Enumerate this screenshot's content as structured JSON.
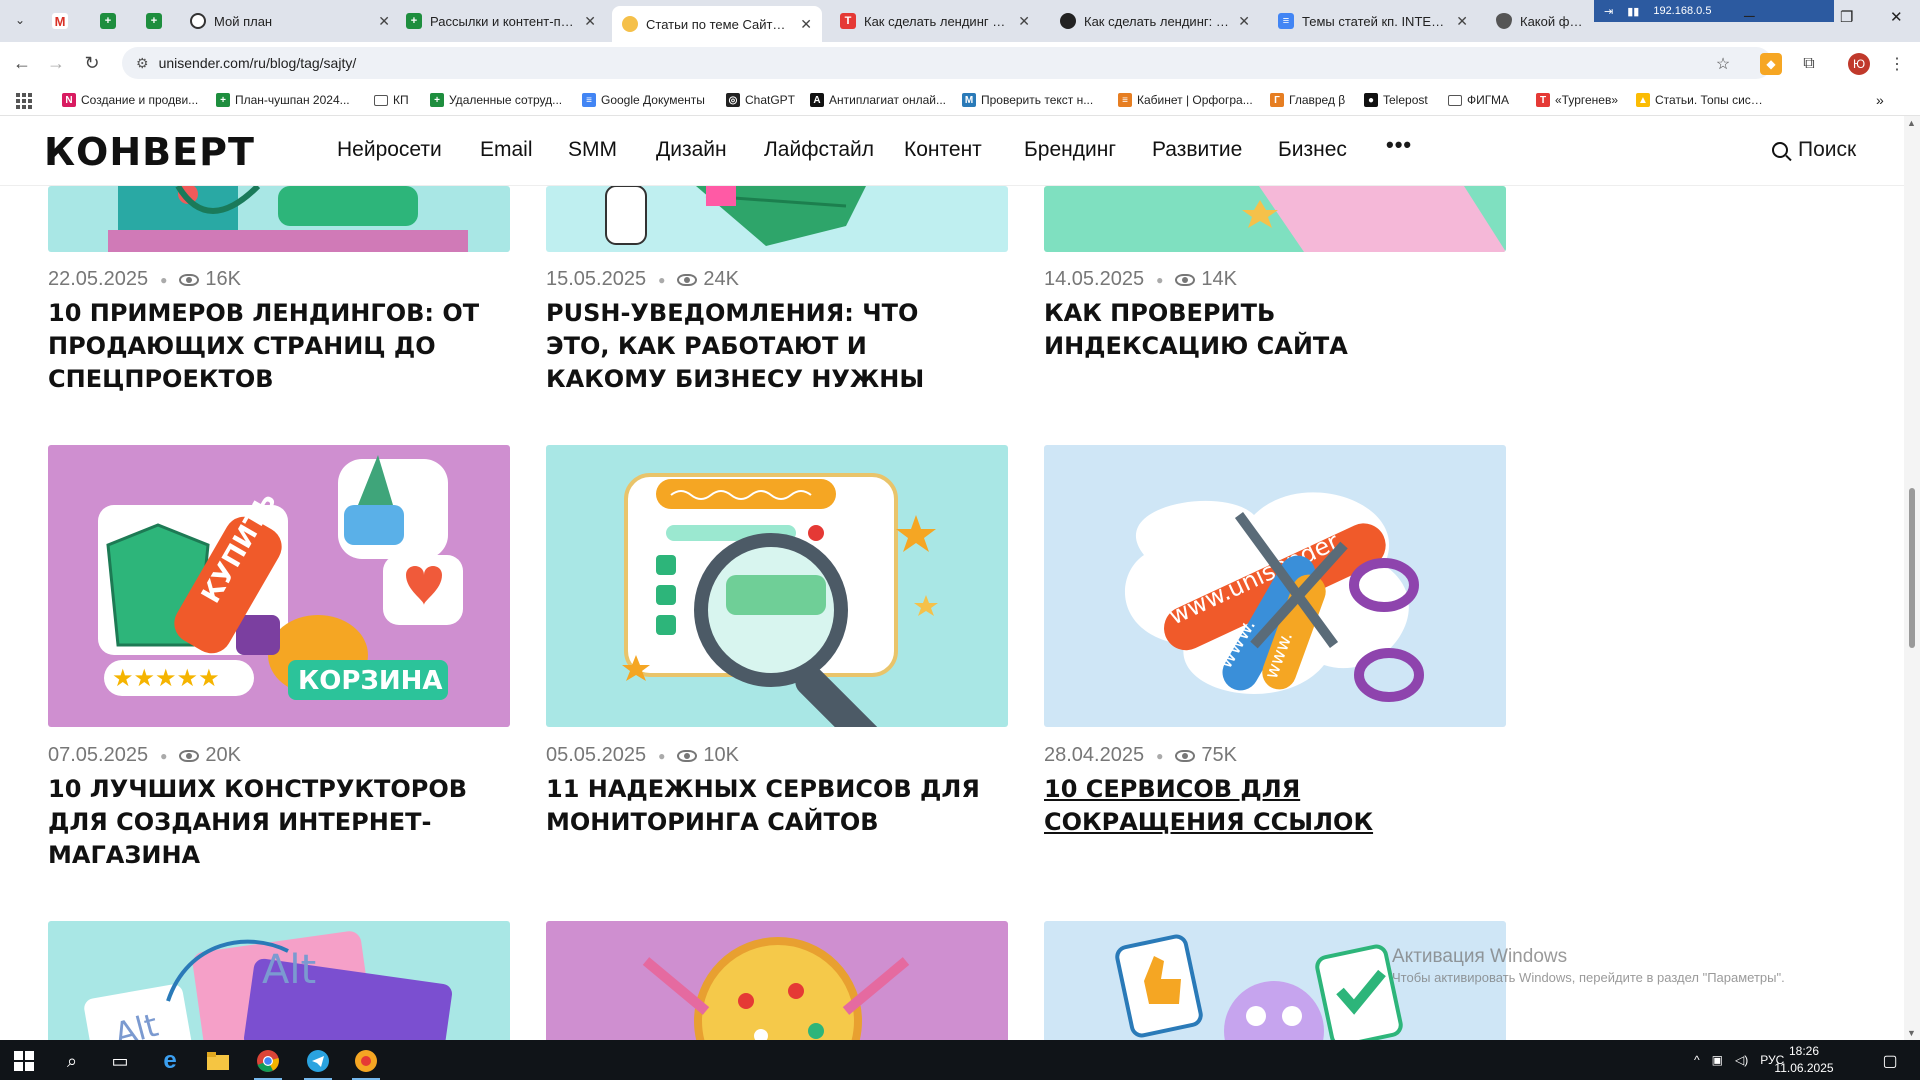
{
  "browser": {
    "tabs": [
      {
        "title": "",
        "icon": "gmail-icon"
      },
      {
        "title": "",
        "icon": "sheets-icon"
      },
      {
        "title": "",
        "icon": "sheets-icon"
      },
      {
        "title": "Мой план",
        "icon": "ring-icon"
      },
      {
        "title": "Рассылки и контент-план",
        "icon": "sheets-icon"
      },
      {
        "title": "Статьи по теме Сайты | Ко",
        "icon": "konvert-icon"
      },
      {
        "title": "Как сделать лендинг для",
        "icon": "t-icon"
      },
      {
        "title": "Как сделать лендинг: пош",
        "icon": "dark-icon"
      },
      {
        "title": "Темы статей кп. INTEC - Go",
        "icon": "docs-icon"
      },
      {
        "title": "Какой форма",
        "icon": "shield-icon"
      }
    ],
    "network_label": "192.168.0.5",
    "address": "unisender.com/ru/blog/tag/sajty/",
    "profile_initial": "Ю",
    "bookmarks": [
      {
        "label": "Создание и продви...",
        "icon": "n-icon",
        "color": "#d81b60"
      },
      {
        "label": "План-чушпан 2024...",
        "icon": "sheets-icon",
        "color": "#1e8e3e"
      },
      {
        "label": "КП",
        "icon": "folder-icon",
        "color": ""
      },
      {
        "label": "Удаленные сотруд...",
        "icon": "sheets-icon",
        "color": "#1e8e3e"
      },
      {
        "label": "Google Документы",
        "icon": "docs-icon",
        "color": "#4285f4"
      },
      {
        "label": "ChatGPT",
        "icon": "chatgpt-icon",
        "color": "#222222"
      },
      {
        "label": "Антиплагиат онлай...",
        "icon": "a-icon",
        "color": "#111111"
      },
      {
        "label": "Проверить текст н...",
        "icon": "m-icon",
        "color": "#2a7ab8"
      },
      {
        "label": "Кабинет | Орфогра...",
        "icon": "lines-icon",
        "color": "#e67e22"
      },
      {
        "label": "Главред β",
        "icon": "glavred-icon",
        "color": "#e67e22"
      },
      {
        "label": "Telepost",
        "icon": "telepost-icon",
        "color": "#111111"
      },
      {
        "label": "ФИГМА",
        "icon": "folder-icon",
        "color": ""
      },
      {
        "label": "«Тургенев»",
        "icon": "t-icon",
        "color": "#e53935"
      },
      {
        "label": "Статьи. Топы систе...",
        "icon": "drive-icon",
        "color": "#fbbc04"
      }
    ]
  },
  "site": {
    "logo": "КОНВЕРТ",
    "menu": [
      "Нейросети",
      "Email",
      "SMM",
      "Дизайн",
      "Лайфстайл",
      "Контент",
      "Брендинг",
      "Развитие",
      "Бизнес"
    ],
    "more": "•••",
    "search_label": "Поиск"
  },
  "articles": [
    {
      "date": "22.05.2025",
      "views": "16K",
      "title": "10 примеров лендингов: от продающих страниц до спецпроектов"
    },
    {
      "date": "15.05.2025",
      "views": "24K",
      "title": "Push-уведомления: что это, как работают и какому бизнесу нужны"
    },
    {
      "date": "14.05.2025",
      "views": "14K",
      "title": "Как проверить индексацию сайта"
    },
    {
      "date": "07.05.2025",
      "views": "20K",
      "title": "10 лучших конструкторов для создания интернет-магазина",
      "image_text": [
        "КУПИТЬ",
        "КОРЗИНА"
      ]
    },
    {
      "date": "05.05.2025",
      "views": "10K",
      "title": "11 надежных сервисов для мониторинга сайтов"
    },
    {
      "date": "28.04.2025",
      "views": "75K",
      "title": "10 сервисов для сокращения ссылок",
      "image_text": [
        "www.unisender",
        "www.",
        "www."
      ]
    },
    {
      "image_text": [
        "Alt",
        "Alt"
      ]
    },
    {},
    {}
  ],
  "os": {
    "activation_title": "Активация Windows",
    "activation_text": "Чтобы активировать Windows, перейдите в раздел \"Параметры\".",
    "language": "РУС",
    "time": "18:26",
    "date": "11.06.2025"
  },
  "colors": {
    "tab_strip": "#dfe3eb",
    "taskbar": "#101418",
    "card_pink": "#cf8fd0",
    "card_mint": "#a9e7e5",
    "card_blue": "#cfe6f6"
  }
}
